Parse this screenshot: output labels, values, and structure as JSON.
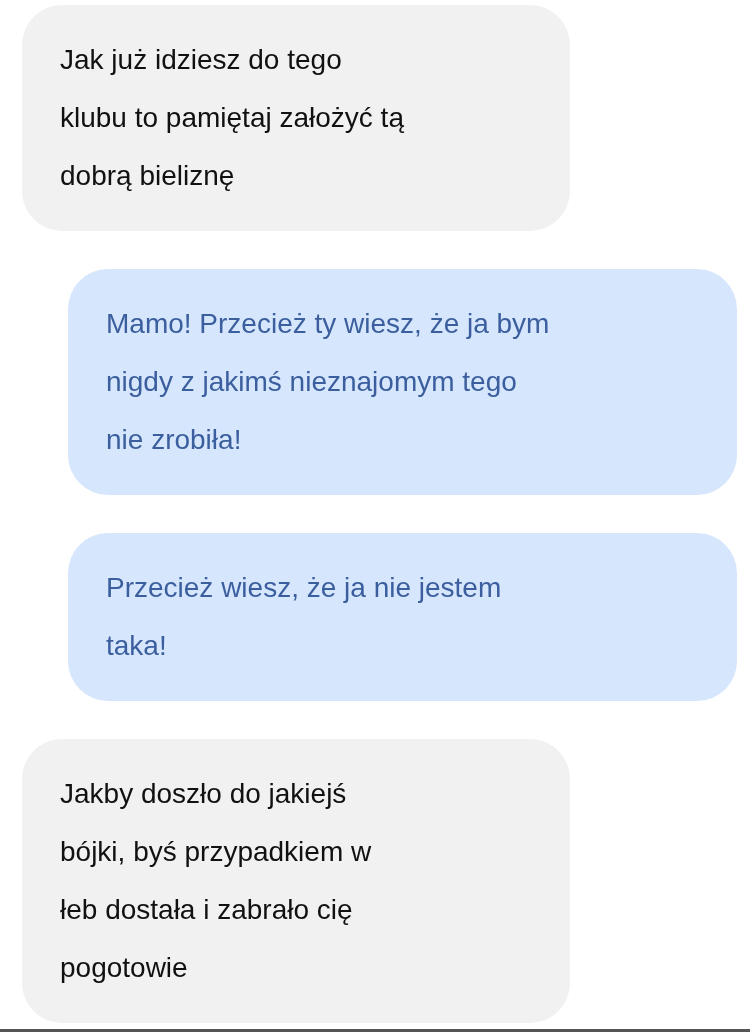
{
  "messages": [
    {
      "kind": "incoming",
      "lines": [
        "Jak już idziesz do tego",
        "klubu to pamiętaj założyć tą",
        "dobrą bieliznę"
      ]
    },
    {
      "kind": "outgoing",
      "lines": [
        "Mamo! Przecież ty wiesz, że ja bym",
        "nigdy z jakimś nieznajomym tego",
        "nie zrobiła!"
      ]
    },
    {
      "kind": "outgoing",
      "lines": [
        "Przecież wiesz, że ja nie jestem",
        "taka!"
      ]
    },
    {
      "kind": "incoming",
      "lines": [
        "Jakby doszło do jakiejś",
        "bójki, byś przypadkiem w",
        "łeb dostała i zabrało cię",
        "pogotowie"
      ]
    }
  ]
}
